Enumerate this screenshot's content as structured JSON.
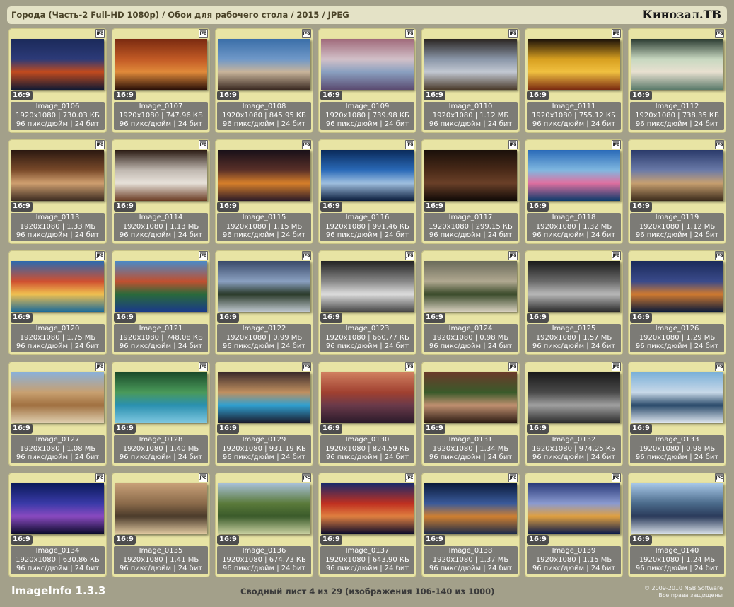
{
  "header": {
    "title": "Города (Часть-2 Full-HD 1080p) / Обои для рабочего стола / 2015 / JPEG",
    "brand": "Кинозал.ТВ"
  },
  "format_badge": "JPG",
  "info_suffix": "96 пикс/дюйм | 24 бит",
  "images": [
    {
      "name": "Image_0106",
      "res": "1920x1080 | 730.03 КБ",
      "ratio": "16:9",
      "colors": [
        "#1b2a5a",
        "#2c3a78",
        "#c14a1e",
        "#111a33"
      ]
    },
    {
      "name": "Image_0107",
      "res": "1920x1080 | 747.96 КБ",
      "ratio": "16:9",
      "colors": [
        "#7a2a10",
        "#c25a25",
        "#e08a3a",
        "#2a1008"
      ]
    },
    {
      "name": "Image_0108",
      "res": "1920x1080 | 845.95 КБ",
      "ratio": "16:9",
      "colors": [
        "#3a6ea8",
        "#6f98c8",
        "#c8b49a",
        "#3a2a22"
      ]
    },
    {
      "name": "Image_0109",
      "res": "1920x1080 | 739.98 КБ",
      "ratio": "16:9",
      "colors": [
        "#a06a7a",
        "#d2c0c8",
        "#8aa0c0",
        "#5a4a70"
      ]
    },
    {
      "name": "Image_0110",
      "res": "1920x1080 | 1.12 МБ",
      "ratio": "16:9",
      "colors": [
        "#2a2420",
        "#8a96a8",
        "#c2c8d2",
        "#4a3a2a"
      ]
    },
    {
      "name": "Image_0111",
      "res": "1920x1080 | 755.12 КБ",
      "ratio": "16:9",
      "colors": [
        "#1a0f08",
        "#d8a020",
        "#f0c040",
        "#7a2a10"
      ]
    },
    {
      "name": "Image_0112",
      "res": "1920x1080 | 738.35 КБ",
      "ratio": "16:9",
      "colors": [
        "#2a3a30",
        "#c8d8c0",
        "#e8e0d0",
        "#5a7a6a"
      ]
    },
    {
      "name": "Image_0113",
      "res": "1920x1080 | 1.33 МБ",
      "ratio": "16:9",
      "colors": [
        "#2a1810",
        "#7a4a2a",
        "#d0a070",
        "#3a2a20"
      ]
    },
    {
      "name": "Image_0114",
      "res": "1920x1080 | 1.13 МБ",
      "ratio": "16:9",
      "colors": [
        "#2a1a12",
        "#c0b8b0",
        "#e8e2da",
        "#6a3a22"
      ]
    },
    {
      "name": "Image_0115",
      "res": "1920x1080 | 1.15 МБ",
      "ratio": "16:9",
      "colors": [
        "#181018",
        "#5a3028",
        "#d8802a",
        "#2a1a28"
      ]
    },
    {
      "name": "Image_0116",
      "res": "1920x1080 | 991.46 КБ",
      "ratio": "16:9",
      "colors": [
        "#0a2a5a",
        "#2a6ab8",
        "#a0c0e0",
        "#081a3a"
      ]
    },
    {
      "name": "Image_0117",
      "res": "1920x1080 | 299.15 КБ",
      "ratio": "16:9",
      "colors": [
        "#1a100a",
        "#4a2a18",
        "#6a4028",
        "#0e0806"
      ]
    },
    {
      "name": "Image_0118",
      "res": "1920x1080 | 1.32 МБ",
      "ratio": "16:9",
      "colors": [
        "#2a6ab8",
        "#80b8e0",
        "#e070a0",
        "#0a3a6a"
      ]
    },
    {
      "name": "Image_0119",
      "res": "1920x1080 | 1.12 МБ",
      "ratio": "16:9",
      "colors": [
        "#2a3a6a",
        "#6a7aa8",
        "#c8a070",
        "#3a2a1a"
      ]
    },
    {
      "name": "Image_0120",
      "res": "1920x1080 | 1.75 МБ",
      "ratio": "16:9",
      "colors": [
        "#2a6ab0",
        "#d05030",
        "#f0c050",
        "#1a6a9a"
      ]
    },
    {
      "name": "Image_0121",
      "res": "1920x1080 | 748.08 КБ",
      "ratio": "16:9",
      "colors": [
        "#4a8ac8",
        "#c05030",
        "#2a6a3a",
        "#1a3a8a"
      ]
    },
    {
      "name": "Image_0122",
      "res": "1920x1080 | 0.99 МБ",
      "ratio": "16:9",
      "colors": [
        "#3a4a6a",
        "#8aa0c0",
        "#2a3a2a",
        "#c0c8d0"
      ]
    },
    {
      "name": "Image_0123",
      "res": "1920x1080 | 660.77 КБ",
      "ratio": "16:9",
      "colors": [
        "#222",
        "#888",
        "#ddd",
        "#444"
      ]
    },
    {
      "name": "Image_0124",
      "res": "1920x1080 | 0.98 МБ",
      "ratio": "16:9",
      "colors": [
        "#6a6a5a",
        "#b0a890",
        "#3a4a2a",
        "#d8d0c0"
      ]
    },
    {
      "name": "Image_0125",
      "res": "1920x1080 | 1.57 МБ",
      "ratio": "16:9",
      "colors": [
        "#1a1a1a",
        "#6a6a6a",
        "#b8b8b8",
        "#2a2a2a"
      ]
    },
    {
      "name": "Image_0126",
      "res": "1920x1080 | 1.29 МБ",
      "ratio": "16:9",
      "colors": [
        "#1a2a5a",
        "#3a4a8a",
        "#d07a30",
        "#0a1a3a"
      ]
    },
    {
      "name": "Image_0127",
      "res": "1920x1080 | 1.08 МБ",
      "ratio": "16:9",
      "colors": [
        "#8ab0d8",
        "#c8a070",
        "#a07040",
        "#e0d0b0"
      ]
    },
    {
      "name": "Image_0128",
      "res": "1920x1080 | 1.40 МБ",
      "ratio": "16:9",
      "colors": [
        "#1a4a2a",
        "#4a9a5a",
        "#2a90b0",
        "#80c8e0"
      ]
    },
    {
      "name": "Image_0129",
      "res": "1920x1080 | 931.19 КБ",
      "ratio": "16:9",
      "colors": [
        "#3a2a2a",
        "#c09060",
        "#30a0d0",
        "#1a1a2a"
      ]
    },
    {
      "name": "Image_0130",
      "res": "1920x1080 | 824.59 КБ",
      "ratio": "16:9",
      "colors": [
        "#d08060",
        "#a04030",
        "#6a3a4a",
        "#2a1a2a"
      ]
    },
    {
      "name": "Image_0131",
      "res": "1920x1080 | 1.34 МБ",
      "ratio": "16:9",
      "colors": [
        "#6a3a2a",
        "#3a5a2a",
        "#c09070",
        "#2a1a12"
      ]
    },
    {
      "name": "Image_0132",
      "res": "1920x1080 | 974.25 КБ",
      "ratio": "16:9",
      "colors": [
        "#1a1a1a",
        "#4a4a4a",
        "#a0a0a0",
        "#2a2a2a"
      ]
    },
    {
      "name": "Image_0133",
      "res": "1920x1080 | 0.98 МБ",
      "ratio": "16:9",
      "colors": [
        "#7ab0d8",
        "#c8d8e8",
        "#2a4a6a",
        "#e0e8f0"
      ]
    },
    {
      "name": "Image_0134",
      "res": "1920x1080 | 630.86 КБ",
      "ratio": "16:9",
      "colors": [
        "#0a1a5a",
        "#3a3aa8",
        "#8a4ac0",
        "#0a0a2a"
      ]
    },
    {
      "name": "Image_0135",
      "res": "1920x1080 | 1.41 МБ",
      "ratio": "16:9",
      "colors": [
        "#c8a078",
        "#8a6a4a",
        "#4a3a2a",
        "#e0c8a0"
      ]
    },
    {
      "name": "Image_0136",
      "res": "1920x1080 | 674.73 КБ",
      "ratio": "16:9",
      "colors": [
        "#a8c0d8",
        "#5a7a3a",
        "#3a5a2a",
        "#c8d0a0"
      ]
    },
    {
      "name": "Image_0137",
      "res": "1920x1080 | 643.90 КБ",
      "ratio": "16:9",
      "colors": [
        "#1a2a6a",
        "#c03020",
        "#e08040",
        "#0a0a2a"
      ]
    },
    {
      "name": "Image_0138",
      "res": "1920x1080 | 1.37 МБ",
      "ratio": "16:9",
      "colors": [
        "#0a1a3a",
        "#3a5a9a",
        "#d08030",
        "#1a2a4a"
      ]
    },
    {
      "name": "Image_0139",
      "res": "1920x1080 | 1.15 МБ",
      "ratio": "16:9",
      "colors": [
        "#2a3a7a",
        "#8a9ad0",
        "#e0a040",
        "#0a1a4a"
      ]
    },
    {
      "name": "Image_0140",
      "res": "1920x1080 | 1.24 МБ",
      "ratio": "16:9",
      "colors": [
        "#a8c8e8",
        "#4a6a8a",
        "#2a3a5a",
        "#d8e0e8"
      ]
    }
  ],
  "footer": {
    "app": "ImageInfo 1.3.3",
    "sheet": "Сводный лист 4 из 29 (изображения 106-140 из 1000)",
    "copyright_line1": "© 2009-2010 NSB Software",
    "copyright_line2": "Все права защищены"
  }
}
